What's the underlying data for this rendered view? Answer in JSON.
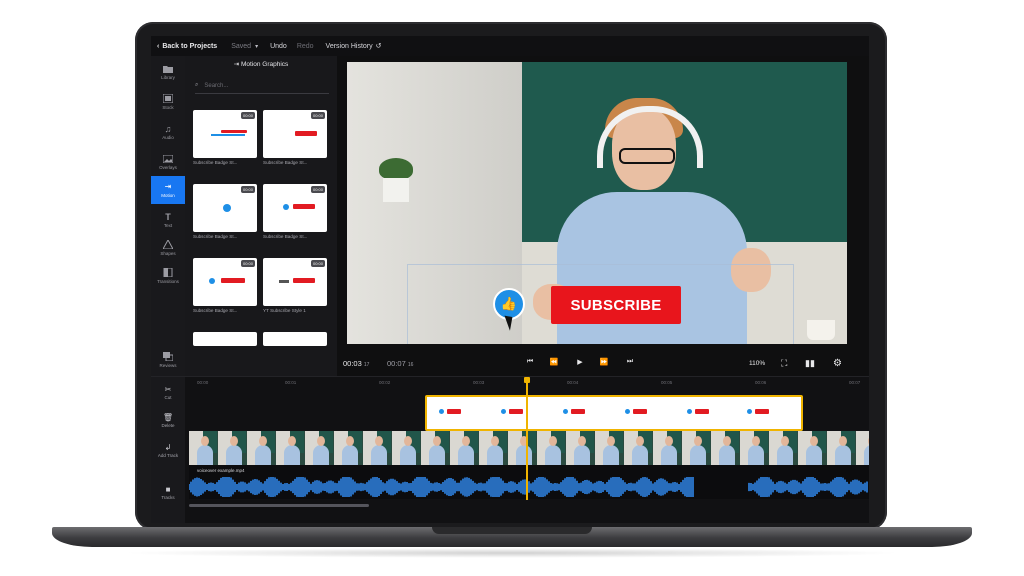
{
  "topbar": {
    "back_label": "Back to Projects",
    "saved_label": "Saved",
    "undo_label": "Undo",
    "redo_label": "Redo",
    "version_history_label": "Version History"
  },
  "sidebar": {
    "items": [
      {
        "label": "Library",
        "icon": "folder-icon"
      },
      {
        "label": "Stock",
        "icon": "stock-icon"
      },
      {
        "label": "Audio",
        "icon": "music-note-icon"
      },
      {
        "label": "Overlays",
        "icon": "overlay-icon"
      },
      {
        "label": "Motion",
        "icon": "motion-icon",
        "active": true
      },
      {
        "label": "Text",
        "icon": "text-icon"
      },
      {
        "label": "Shapes",
        "icon": "shapes-icon"
      },
      {
        "label": "Transitions",
        "icon": "transitions-icon"
      },
      {
        "label": "Reviews",
        "icon": "reviews-icon"
      }
    ]
  },
  "panel": {
    "title": "Motion Graphics",
    "search_placeholder": "Search...",
    "tiles": [
      {
        "label": "Subscribe Badge St...",
        "badge": "00:00"
      },
      {
        "label": "Subscribe Badge St...",
        "badge": "00:00"
      },
      {
        "label": "Subscribe Badge St...",
        "badge": "00:00"
      },
      {
        "label": "Subscribe Badge St...",
        "badge": "00:00"
      },
      {
        "label": "Subscribe Badge St...",
        "badge": "00:00"
      },
      {
        "label": "YT Subscribe Style 1",
        "badge": "00:00"
      }
    ]
  },
  "preview": {
    "subscribe_text": "SUBSCRIBE"
  },
  "transport": {
    "current_time": "00:03",
    "current_frames": "17",
    "duration": "00:07",
    "duration_frames": "16",
    "zoom": "110%"
  },
  "timeline": {
    "tools": [
      {
        "label": "Cut",
        "icon": "scissors-icon"
      },
      {
        "label": "Delete",
        "icon": "trash-icon"
      },
      {
        "label": "Add Track",
        "icon": "add-track-icon"
      },
      {
        "label": "Tracks",
        "icon": "tracks-icon"
      }
    ],
    "ruler_ticks": [
      "00:00",
      "00:01",
      "00:02",
      "00:03",
      "00:04",
      "00:05",
      "00:06",
      "00:07"
    ],
    "audio_clip_label": "voiceover example.mp4"
  },
  "colors": {
    "accent": "#1877f2",
    "subscribe_red": "#e8151c",
    "playhead": "#f0b400"
  }
}
